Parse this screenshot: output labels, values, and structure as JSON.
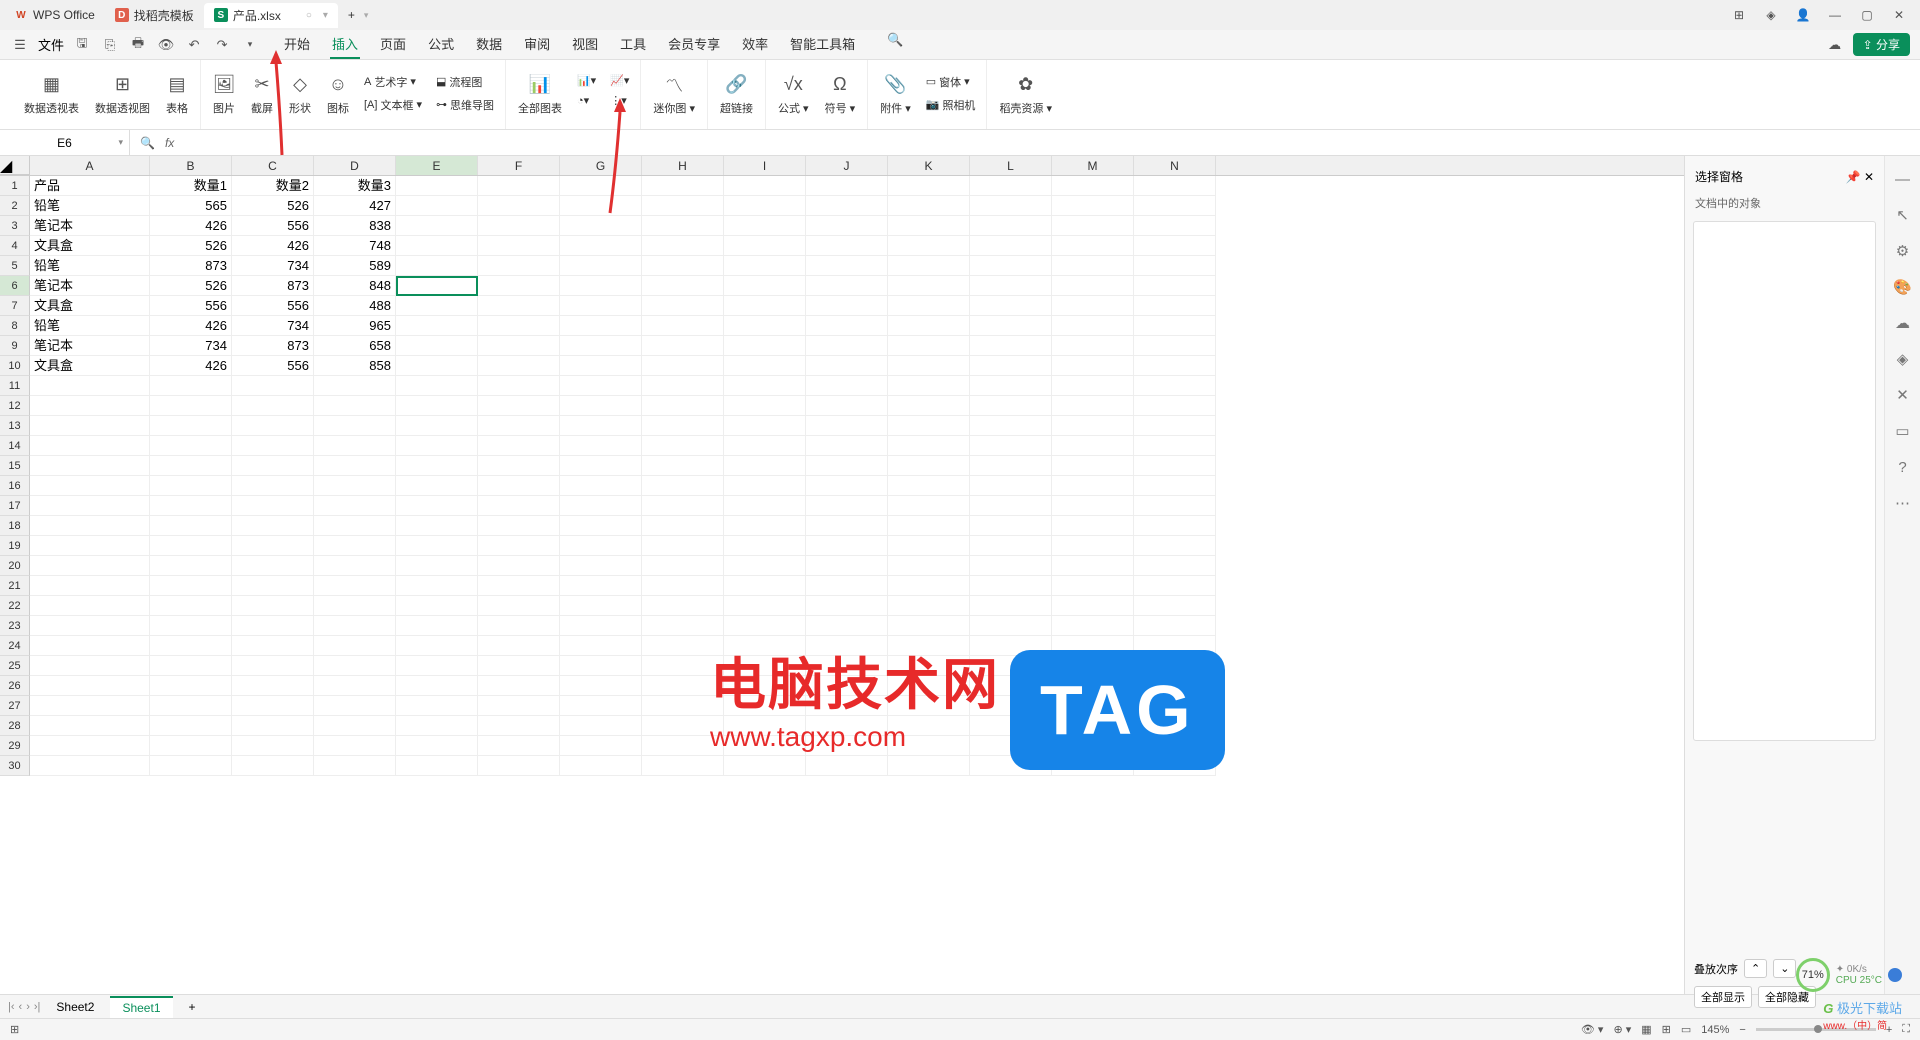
{
  "tabs": {
    "wps": "WPS Office",
    "template": "找稻壳模板",
    "file": "产品.xlsx"
  },
  "menu": {
    "file": "文件",
    "items": [
      "开始",
      "插入",
      "页面",
      "公式",
      "数据",
      "审阅",
      "视图",
      "工具",
      "会员专享",
      "效率",
      "智能工具箱"
    ],
    "active": "插入",
    "share": "分享"
  },
  "ribbon": {
    "pivot_table": "数据透视表",
    "pivot_chart": "数据透视图",
    "table": "表格",
    "picture": "图片",
    "screenshot": "截屏",
    "shapes": "形状",
    "icons": "图标",
    "wordart": "艺术字",
    "textbox": "文本框",
    "flowchart": "流程图",
    "mindmap": "思维导图",
    "all_charts": "全部图表",
    "sparkline": "迷你图",
    "hyperlink": "超链接",
    "formula": "公式",
    "symbol": "符号",
    "attachment": "附件",
    "camera": "照相机",
    "object": "窗体",
    "resources": "稻壳资源"
  },
  "namebox": "E6",
  "columns": [
    "A",
    "B",
    "C",
    "D",
    "E",
    "F",
    "G",
    "H",
    "I",
    "J",
    "K",
    "L",
    "M",
    "N"
  ],
  "headers": [
    "产品",
    "数量1",
    "数量2",
    "数量3"
  ],
  "rows": [
    {
      "a": "铅笔",
      "b": 565,
      "c": 526,
      "d": 427
    },
    {
      "a": "笔记本",
      "b": 426,
      "c": 556,
      "d": 838
    },
    {
      "a": "文具盒",
      "b": 526,
      "c": 426,
      "d": 748
    },
    {
      "a": "铅笔",
      "b": 873,
      "c": 734,
      "d": 589
    },
    {
      "a": "笔记本",
      "b": 526,
      "c": 873,
      "d": 848
    },
    {
      "a": "文具盒",
      "b": 556,
      "c": 556,
      "d": 488
    },
    {
      "a": "铅笔",
      "b": 426,
      "c": 734,
      "d": 965
    },
    {
      "a": "笔记本",
      "b": 734,
      "c": 873,
      "d": 658
    },
    {
      "a": "文具盒",
      "b": 426,
      "c": 556,
      "d": 858
    }
  ],
  "side": {
    "title": "选择窗格",
    "subtitle": "文档中的对象",
    "order": "叠放次序",
    "show_all": "全部显示",
    "hide_all": "全部隐藏"
  },
  "sheets": {
    "s1": "Sheet2",
    "s2": "Sheet1"
  },
  "status": {
    "zoom": "145%"
  },
  "watermark": {
    "text": "电脑技术网",
    "url": "www.tagxp.com",
    "tag": "TAG",
    "jiguang": "极光下载站",
    "perf": "71%",
    "net": "0K/s",
    "cpu": "CPU 25°C"
  }
}
